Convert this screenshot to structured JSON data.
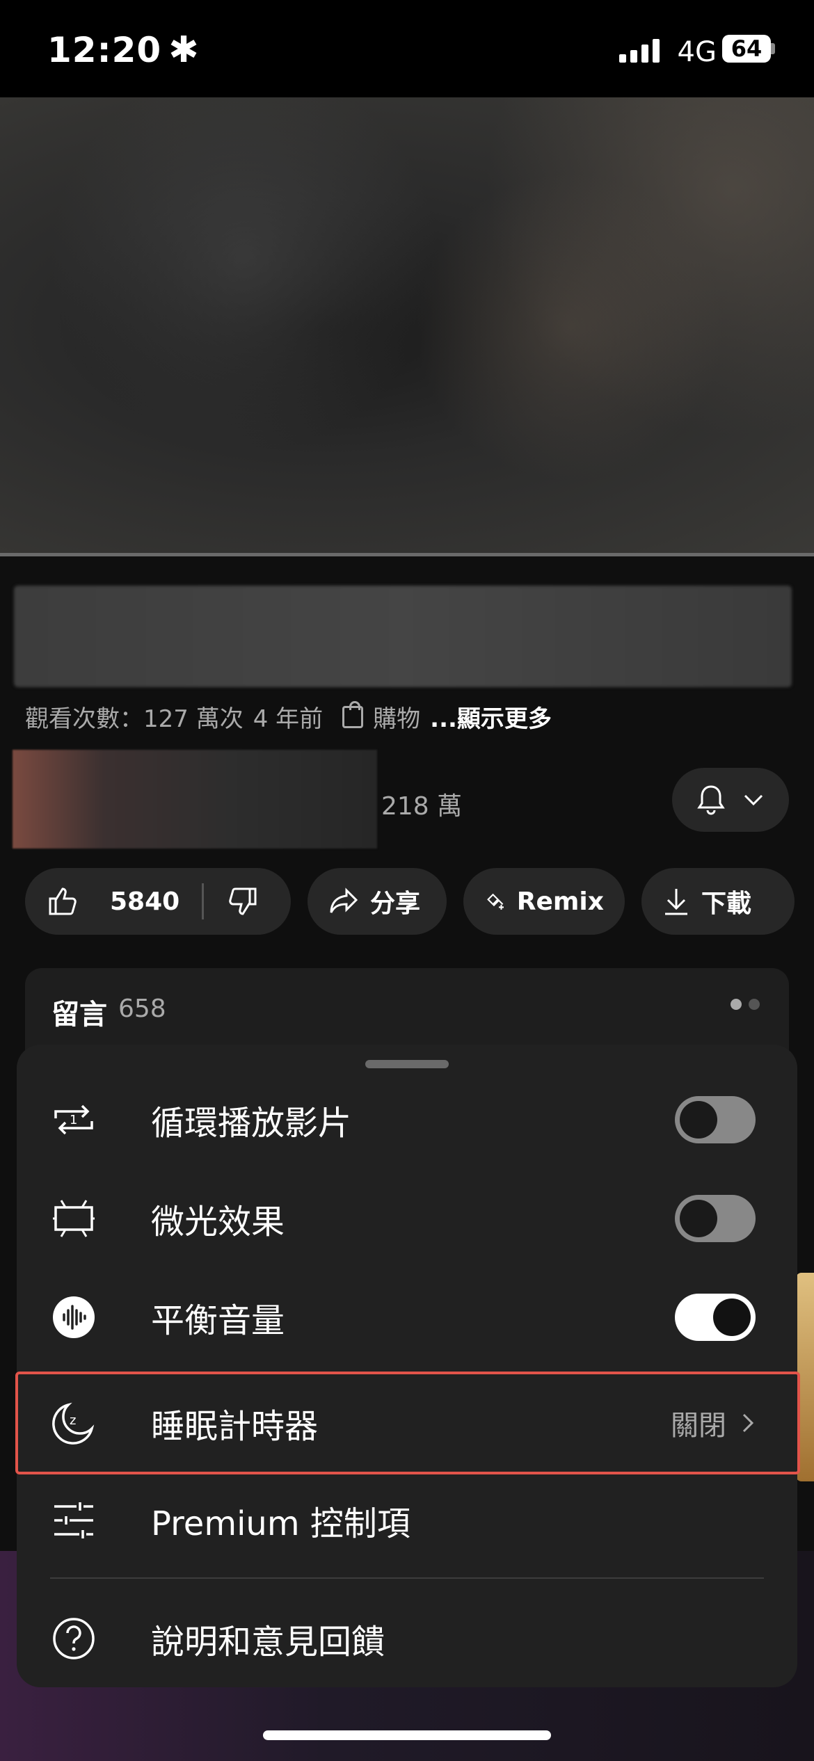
{
  "status_bar": {
    "time": "12:20",
    "time_symbol": "✱",
    "network": "4G",
    "battery": "64"
  },
  "video": {
    "progress": 0.0
  },
  "video_info": {
    "views": "觀看次數：127 萬次",
    "age": "4 年前",
    "shopping": "購物",
    "more": "...顯示更多"
  },
  "channel": {
    "subscribers": "218 萬"
  },
  "actions": {
    "likes": "5840",
    "share": "分享",
    "remix": "Remix",
    "download": "下載"
  },
  "comments": {
    "title": "留言",
    "count": "658"
  },
  "sheet": {
    "items": [
      {
        "label": "循環播放影片",
        "icon": "loop-icon",
        "toggle": false
      },
      {
        "label": "微光效果",
        "icon": "ambient-mode-icon",
        "toggle": false
      },
      {
        "label": "平衡音量",
        "icon": "stable-volume-icon",
        "toggle": true
      },
      {
        "label": "睡眠計時器",
        "icon": "sleep-timer-icon",
        "value": "關閉",
        "highlighted": true
      },
      {
        "label": "Premium 控制項",
        "icon": "sliders-icon"
      },
      {
        "label": "說明和意見回饋",
        "icon": "help-icon"
      }
    ]
  },
  "colors": {
    "highlight": "#e2544a",
    "background": "#0f0f0f",
    "sheet": "#212121"
  }
}
